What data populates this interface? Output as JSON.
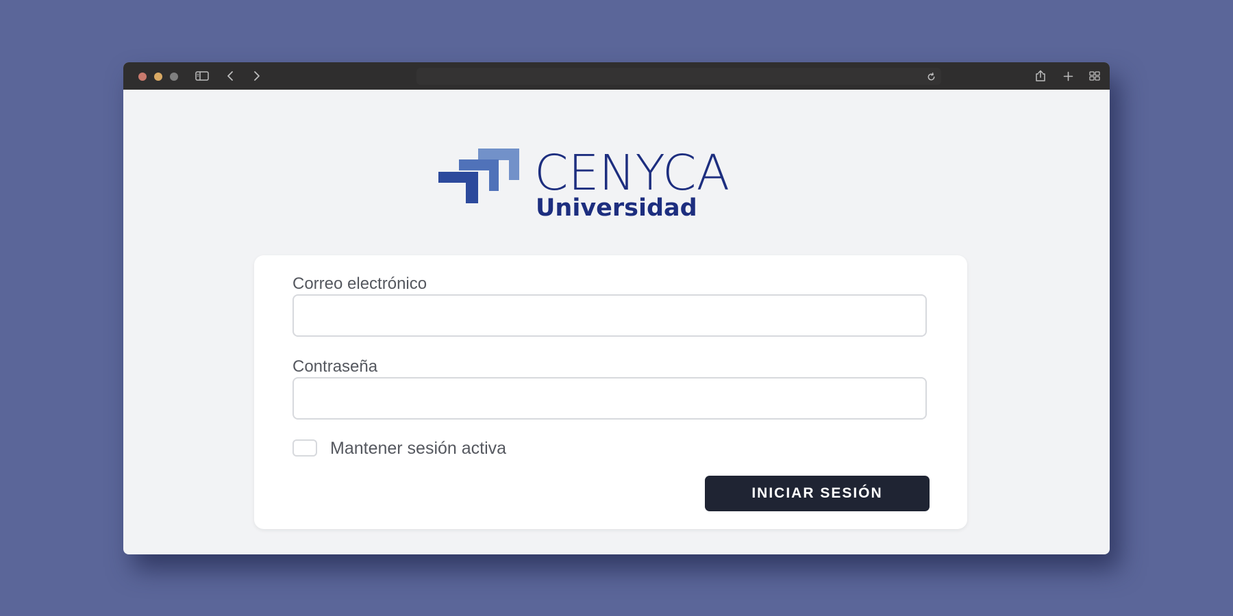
{
  "browser": {
    "address_text": "",
    "icons": {
      "sidebar": "sidebar-icon",
      "back": "chevron-left-icon",
      "forward": "chevron-right-icon",
      "reload": "reload-icon",
      "share": "share-icon",
      "new_tab": "plus-icon",
      "tab_overview": "tabs-grid-icon"
    }
  },
  "logo": {
    "brand": "CENYCA",
    "subtitle": "Universidad",
    "colors": {
      "text": "#1d2e7f",
      "mark_light": "#7291c9",
      "mark_mid": "#5072b9",
      "mark_dark": "#2d4a9c"
    }
  },
  "login_form": {
    "email_label": "Correo electrónico",
    "email_value": "",
    "password_label": "Contraseña",
    "password_value": "",
    "remember_label": "Mantener sesión activa",
    "remember_checked": false,
    "submit_label": "INICIAR SESIÓN"
  },
  "colors": {
    "backdrop": "#5b6699",
    "page_background": "#f2f3f5",
    "button_background": "#1f2433"
  }
}
